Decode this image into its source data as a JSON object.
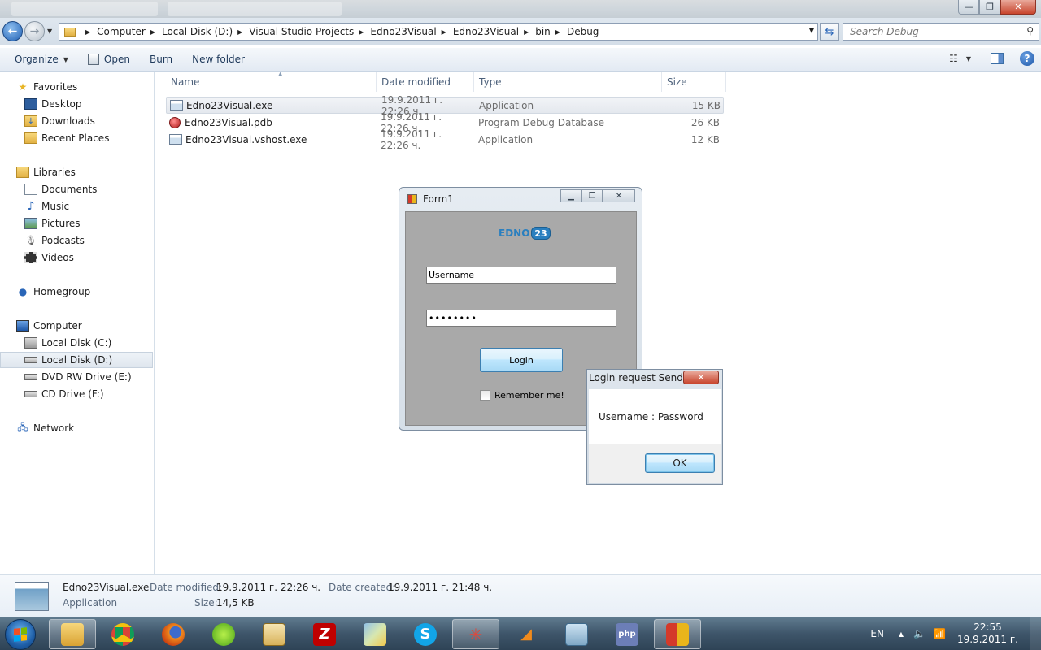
{
  "window": {
    "controls": {
      "minimize": "—",
      "maximize": "❐",
      "close": "✕"
    }
  },
  "address": {
    "crumbs": [
      "Computer",
      "Local Disk (D:)",
      "Visual Studio Projects",
      "Edno23Visual",
      "Edno23Visual",
      "bin",
      "Debug"
    ],
    "search_placeholder": "Search Debug"
  },
  "toolbar": {
    "organize": "Organize",
    "open": "Open",
    "burn": "Burn",
    "new_folder": "New folder"
  },
  "nav": {
    "favorites": "Favorites",
    "desktop": "Desktop",
    "downloads": "Downloads",
    "recent_places": "Recent Places",
    "libraries": "Libraries",
    "documents": "Documents",
    "music": "Music",
    "pictures": "Pictures",
    "podcasts": "Podcasts",
    "videos": "Videos",
    "homegroup": "Homegroup",
    "computer": "Computer",
    "local_c": "Local Disk (C:)",
    "local_d": "Local Disk (D:)",
    "dvd_e": "DVD RW Drive (E:)",
    "cd_f": "CD Drive (F:)",
    "network": "Network"
  },
  "columns": {
    "name": "Name",
    "date": "Date modified",
    "type": "Type",
    "size": "Size"
  },
  "files": [
    {
      "name": "Edno23Visual.exe",
      "date": "19.9.2011 г. 22:26 ч.",
      "type": "Application",
      "size": "15 KB"
    },
    {
      "name": "Edno23Visual.pdb",
      "date": "19.9.2011 г. 22:26 ч.",
      "type": "Program Debug Database",
      "size": "26 KB"
    },
    {
      "name": "Edno23Visual.vshost.exe",
      "date": "19.9.2011 г. 22:26 ч.",
      "type": "Application",
      "size": "12 KB"
    }
  ],
  "form1": {
    "title": "Form1",
    "logo_text": "EDNO",
    "logo_badge": "23",
    "username_value": "Username",
    "password_value": "••••••••",
    "login_label": "Login",
    "remember_label": "Remember me!",
    "remember_checked": false
  },
  "msgbox": {
    "title": "Login request Send...",
    "message": "Username : Password",
    "ok_label": "OK",
    "close": "✕"
  },
  "details": {
    "filename": "Edno23Visual.exe",
    "type": "Application",
    "date_modified_label": "Date modified:",
    "date_modified": "19.9.2011 г. 22:26 ч.",
    "date_created_label": "Date created:",
    "date_created": "19.9.2011 г. 21:48 ч.",
    "size_label": "Size:",
    "size": "14,5 KB"
  },
  "taskbar": {
    "language": "EN",
    "time": "22:55",
    "date": "19.9.2011 г."
  },
  "colors": {
    "taskbar": "#3e556a",
    "selection": "#e4e8ee",
    "button_border": "#3c7fb1"
  }
}
